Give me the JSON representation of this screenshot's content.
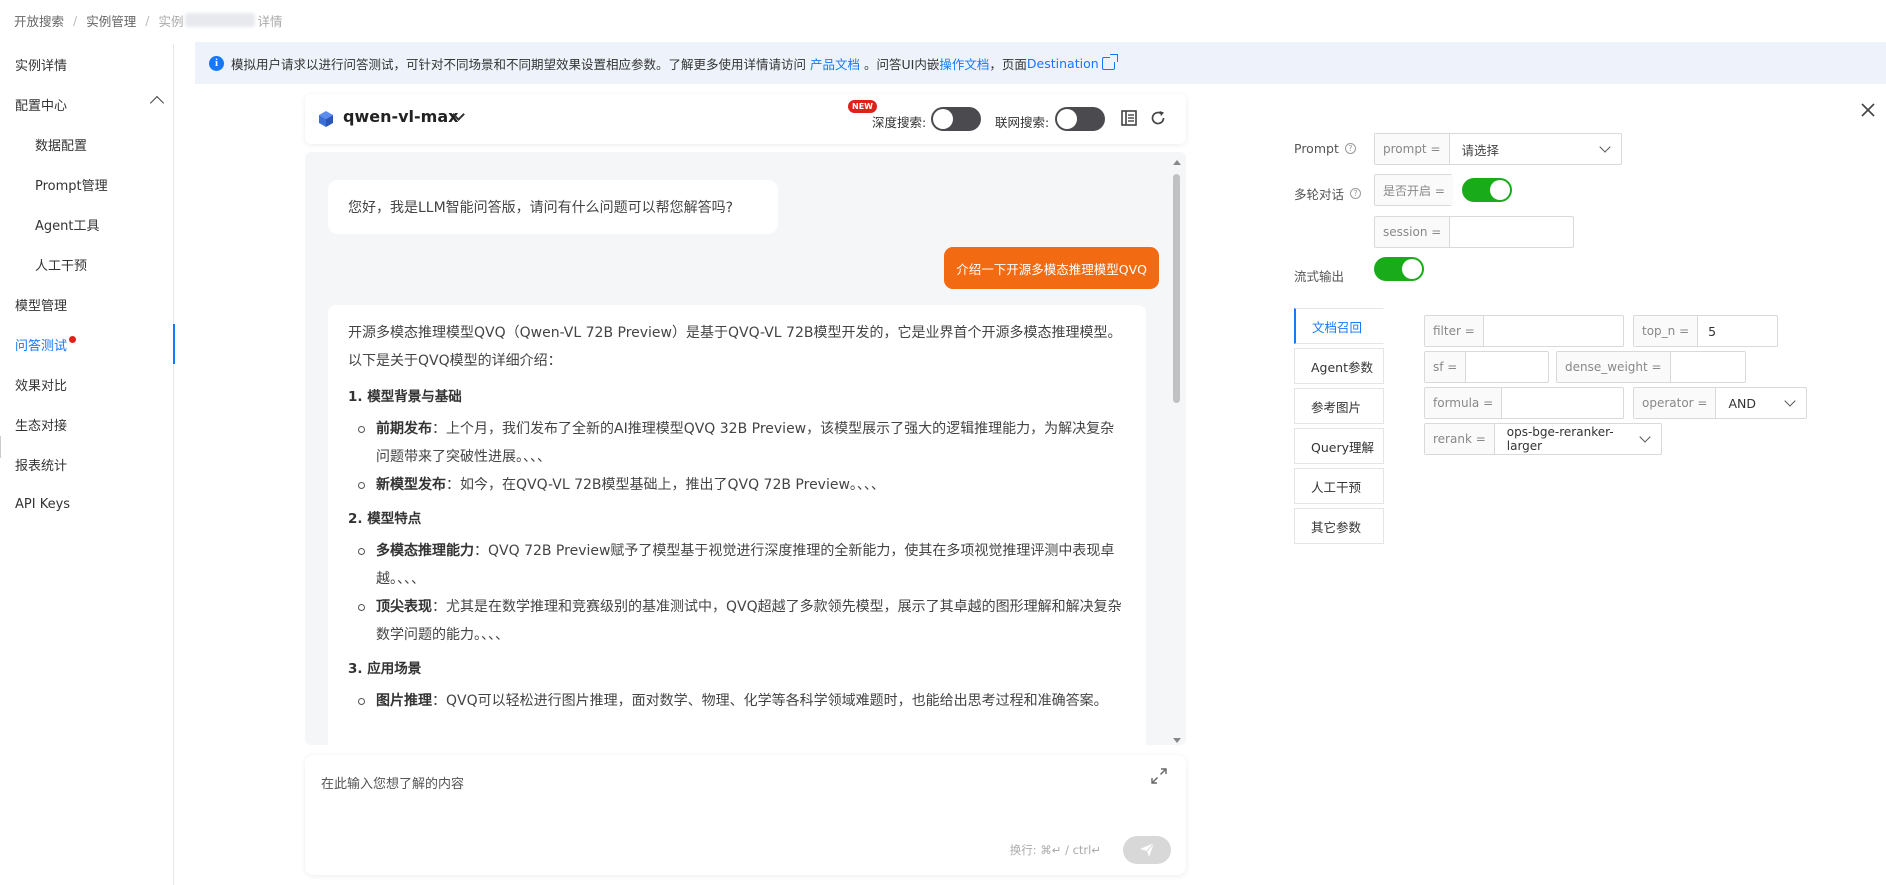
{
  "breadcrumb": {
    "items": [
      "开放搜索",
      "实例管理",
      "实例",
      "详情"
    ]
  },
  "sidebar": {
    "items": [
      {
        "label": "实例详情"
      },
      {
        "label": "配置中心"
      },
      {
        "label": "数据配置"
      },
      {
        "label": "Prompt管理"
      },
      {
        "label": "Agent工具"
      },
      {
        "label": "人工干预"
      },
      {
        "label": "模型管理"
      },
      {
        "label": "问答测试"
      },
      {
        "label": "效果对比"
      },
      {
        "label": "生态对接"
      },
      {
        "label": "报表统计"
      },
      {
        "label": "API Keys"
      }
    ],
    "active": "问答测试"
  },
  "banner": {
    "text1": "模拟用户请求以进行问答测试，可针对不同场景和不同期望效果设置相应参数。了解更多使用详情请访问",
    "link1": "产品文档",
    "text2": "。问答UI内嵌",
    "link2": "操作文档",
    "text3": "，页面",
    "link3": "Destination"
  },
  "chat_header": {
    "model": "qwen-vl-max",
    "new_badge": "NEW",
    "deep_search_label": "深度搜索:",
    "deep_search_on": false,
    "web_search_label": "联网搜索:",
    "web_search_on": false
  },
  "chat": {
    "greeting": "您好，我是LLM智能问答版，请问有什么问题可以帮您解答吗?",
    "user_message": "介绍一下开源多模态推理模型QVQ",
    "answer": {
      "intro": "开源多模态推理模型QVQ（Qwen-VL 72B Preview）是基于QVQ-VL 72B模型开发的，它是业界首个开源多模态推理模型。以下是关于QVQ模型的详细介绍：",
      "sections": [
        {
          "heading": "1. 模型背景与基础",
          "items": [
            {
              "term": "前期发布",
              "text": "：上个月，我们发布了全新的AI推理模型QVQ 32B Preview，该模型展示了强大的逻辑推理能力，为解决复杂问题带来了突破性进展。、、、"
            },
            {
              "term": "新模型发布",
              "text": "：如今，在QVQ-VL 72B模型基础上，推出了QVQ 72B Preview。、、、"
            }
          ]
        },
        {
          "heading": "2. 模型特点",
          "items": [
            {
              "term": "多模态推理能力",
              "text": "：QVQ 72B Preview赋予了模型基于视觉进行深度推理的全新能力，使其在多项视觉推理评测中表现卓越。、、、"
            },
            {
              "term": "顶尖表现",
              "text": "：尤其是在数学推理和竞赛级别的基准测试中，QVQ超越了多款领先模型，展示了其卓越的图形理解和解决复杂数学问题的能力。、、、"
            }
          ]
        },
        {
          "heading": "3. 应用场景",
          "items": [
            {
              "term": "图片推理",
              "text": "：QVQ可以轻松进行图片推理，面对数学、物理、化学等各科学领域难题时，也能给出思考过程和准确答案。"
            }
          ]
        }
      ]
    }
  },
  "input": {
    "placeholder": "在此输入您想了解的内容",
    "hint": "换行: ⌘↵ / ctrl↵"
  },
  "params": {
    "prompt_label": "Prompt",
    "prompt_prefix": "prompt =",
    "prompt_value": "请选择",
    "multi_turn_label": "多轮对话",
    "enable_prefix": "是否开启 =",
    "multi_turn_on": true,
    "session_prefix": "session =",
    "session_value": "",
    "stream_label": "流式输出",
    "stream_on": true,
    "tabs": [
      "文档召回",
      "Agent参数",
      "参考图片",
      "Query理解",
      "人工干预",
      "其它参数"
    ],
    "active_tab": "文档召回",
    "filter_prefix": "filter =",
    "filter_value": "",
    "top_n_prefix": "top_n =",
    "top_n_value": "5",
    "sf_prefix": "sf =",
    "sf_value": "",
    "dense_weight_prefix": "dense_weight =",
    "dense_weight_value": "",
    "formula_prefix": "formula =",
    "formula_value": "",
    "operator_prefix": "operator =",
    "operator_value": "AND",
    "rerank_prefix": "rerank =",
    "rerank_value": "ops-bge-reranker-larger"
  },
  "colors": {
    "accent": "#1677ff",
    "user_bubble": "#f26a11",
    "toggle_on": "#1aab1a",
    "toggle_off": "#4b4b4f",
    "badge": "#e0201b"
  }
}
